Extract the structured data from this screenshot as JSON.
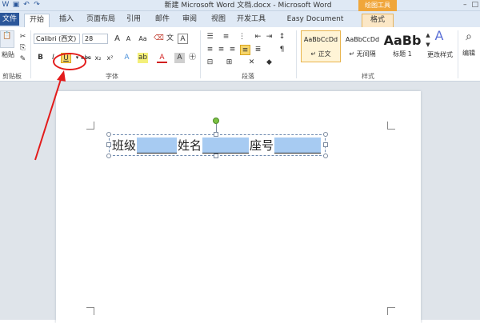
{
  "window": {
    "title": "新建 Microsoft Word 文档.docx - Microsoft Word",
    "contextual_tab_group": "绘图工具"
  },
  "tabs": [
    {
      "label": "文件"
    },
    {
      "label": "开始"
    },
    {
      "label": "插入"
    },
    {
      "label": "页面布局"
    },
    {
      "label": "引用"
    },
    {
      "label": "邮件"
    },
    {
      "label": "审阅"
    },
    {
      "label": "视图"
    },
    {
      "label": "开发工具"
    },
    {
      "label": "Easy Document Creator"
    },
    {
      "label": "格式"
    }
  ],
  "clipboard": {
    "paste_label": "粘贴",
    "group_label": "剪贴板"
  },
  "font": {
    "name": "Calibri (西文)",
    "size": "28",
    "group_label": "字体",
    "bold": "B",
    "italic": "I",
    "underline": "U",
    "strike": "abc",
    "subscript": "x₂",
    "superscript": "x²",
    "grow": "A",
    "shrink": "A",
    "case": "Aa",
    "wen": "文",
    "clear": "A"
  },
  "paragraph": {
    "group_label": "段落"
  },
  "styles": {
    "group_label": "样式",
    "items": [
      {
        "sample": "AaBbCcDd",
        "name": "↵ 正文"
      },
      {
        "sample": "AaBbCcDd",
        "name": "↵ 无间隔"
      },
      {
        "sample": "AaBb",
        "name": "标题 1"
      }
    ],
    "change_label": "更改样式"
  },
  "editing": {
    "label": "编辑"
  },
  "document": {
    "label_class": "班级",
    "label_name": "姓名",
    "label_seat": "座号"
  },
  "colors": {
    "accent": "#2b579a",
    "annotation": "#e31b1b",
    "field_fill": "#a7cbf2"
  }
}
